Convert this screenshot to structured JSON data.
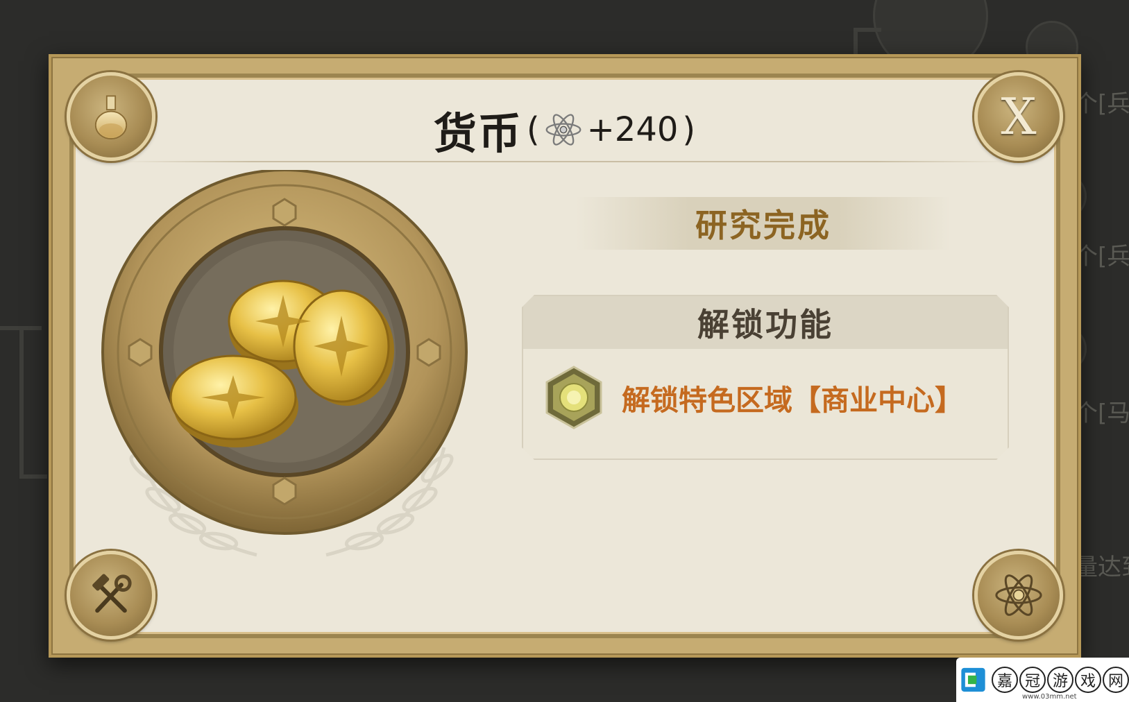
{
  "background": {
    "labels": [
      "个[兵",
      "个[兵",
      "个[马",
      "量达到"
    ]
  },
  "dialog": {
    "title": "货币",
    "reward_open": "(",
    "reward_value": "+240",
    "reward_close": ")",
    "reward_icon": "atom-icon",
    "close_label": "X",
    "status": "研究完成",
    "unlock_header": "解锁功能",
    "unlock_item": "解锁特色区域【商业中心】",
    "unlock_item_icon": "coin-hex-icon",
    "corner_icons": [
      "flask-icon",
      "close-icon",
      "tools-icon",
      "atom-icon"
    ],
    "medallion_icon": "gold-coins-icon"
  },
  "colors": {
    "frame": "#c6ac72",
    "panel": "#ece7d9",
    "status_text": "#8c6422",
    "unlock_text": "#c56a1f"
  },
  "watermark": {
    "chars": [
      "嘉",
      "冠",
      "游",
      "戏",
      "网"
    ],
    "url": "www.03mm.net"
  }
}
